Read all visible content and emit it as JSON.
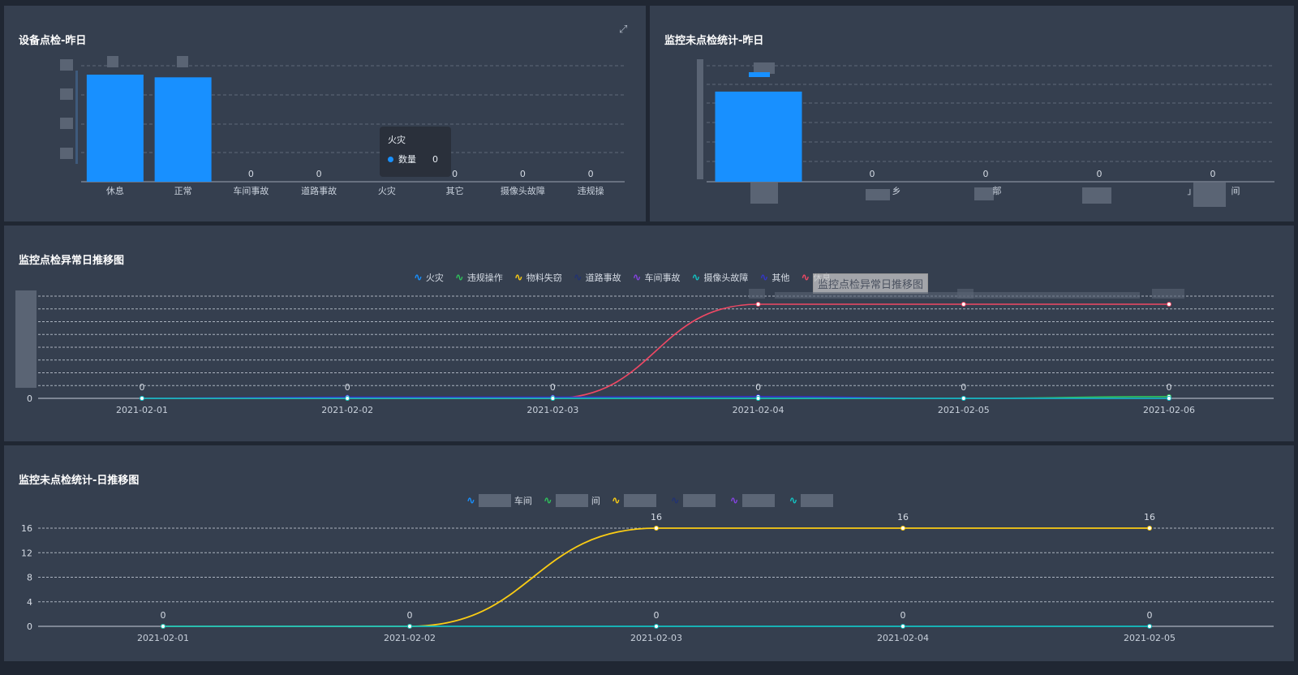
{
  "panel1": {
    "title": "设备点检-昨日",
    "expand_icon": "expand-icon",
    "chart_data": {
      "type": "bar",
      "categories": [
        "休息",
        "正常",
        "车间事故",
        "道路事故",
        "火灾",
        "其它",
        "摄像头故障",
        "违规操"
      ],
      "values": [
        40,
        39,
        0,
        0,
        0,
        0,
        0,
        0
      ],
      "ylim": [
        0,
        40
      ],
      "color": "#1890ff"
    },
    "tooltip": {
      "title": "火灾",
      "series": "数量",
      "value": "0"
    }
  },
  "panel2": {
    "title": "监控未点检统计-昨日",
    "chart_data": {
      "type": "bar",
      "categories": [
        "",
        "",
        "",
        "",
        ""
      ],
      "values": [
        16,
        0,
        0,
        0,
        0
      ],
      "ylim": [
        0,
        18
      ],
      "color": "#1890ff"
    },
    "partial_labels": [
      "",
      "乡",
      "鄁",
      "",
      "」",
      "间"
    ]
  },
  "panel3": {
    "title": "监控点检异常日推移图",
    "legend": [
      {
        "name": "火灾",
        "color": "#1890ff"
      },
      {
        "name": "违规操作",
        "color": "#2fc25b"
      },
      {
        "name": "物料失窃",
        "color": "#facc14"
      },
      {
        "name": "道路事故",
        "color": "#223273"
      },
      {
        "name": "车间事故",
        "color": "#8543e0"
      },
      {
        "name": "摄像头故障",
        "color": "#13c2c2"
      },
      {
        "name": "其他",
        "color": "#3436c7"
      },
      {
        "name": "休息",
        "color": "#f04864"
      }
    ],
    "hover_tip": "监控点检异常日推移图",
    "chart_data": {
      "type": "line",
      "x": [
        "2021-02-01",
        "2021-02-02",
        "2021-02-03",
        "2021-02-04",
        "2021-02-05",
        "2021-02-06"
      ],
      "series": [
        {
          "name": "休息",
          "color": "#f04864",
          "values": [
            0,
            0,
            0,
            16,
            16,
            16
          ]
        },
        {
          "name": "违规操作",
          "color": "#2fc25b",
          "values": [
            0,
            0,
            0,
            0,
            0,
            0.3
          ]
        },
        {
          "name": "其他",
          "color": "#3436c7",
          "values": [
            0,
            0.2,
            0.2,
            0.3,
            0,
            0
          ]
        },
        {
          "name": "摄像头故障",
          "color": "#13c2c2",
          "values": [
            0,
            0,
            0,
            0,
            0,
            0
          ]
        }
      ],
      "data_labels": [
        "0",
        "0",
        "0",
        "0",
        "0",
        "0"
      ],
      "y_tick": "0",
      "ylim": [
        0,
        16
      ]
    }
  },
  "panel4": {
    "title": "监控未点检统计-日推移图",
    "legend": [
      {
        "name": "车间",
        "color": "#1890ff"
      },
      {
        "name": "间",
        "color": "#2fc25b"
      },
      {
        "name": "",
        "color": "#facc14"
      },
      {
        "name": "",
        "color": "#223273"
      },
      {
        "name": "",
        "color": "#8543e0"
      },
      {
        "name": "",
        "color": "#13c2c2"
      }
    ],
    "chart_data": {
      "type": "line",
      "x": [
        "2021-02-01",
        "2021-02-02",
        "2021-02-03",
        "2021-02-04",
        "2021-02-05"
      ],
      "y_ticks": [
        "0",
        "4",
        "8",
        "12",
        "16"
      ],
      "ylim": [
        0,
        16
      ],
      "series": [
        {
          "name": "yellow",
          "color": "#facc14",
          "values": [
            0,
            0,
            16,
            16,
            16
          ]
        },
        {
          "name": "cyan",
          "color": "#13c2c2",
          "values": [
            0,
            0,
            0,
            0,
            0
          ]
        }
      ],
      "top_labels": [
        "",
        "",
        "16",
        "16",
        "16"
      ],
      "bottom_labels": [
        "0",
        "0",
        "0",
        "0",
        "0"
      ]
    }
  }
}
